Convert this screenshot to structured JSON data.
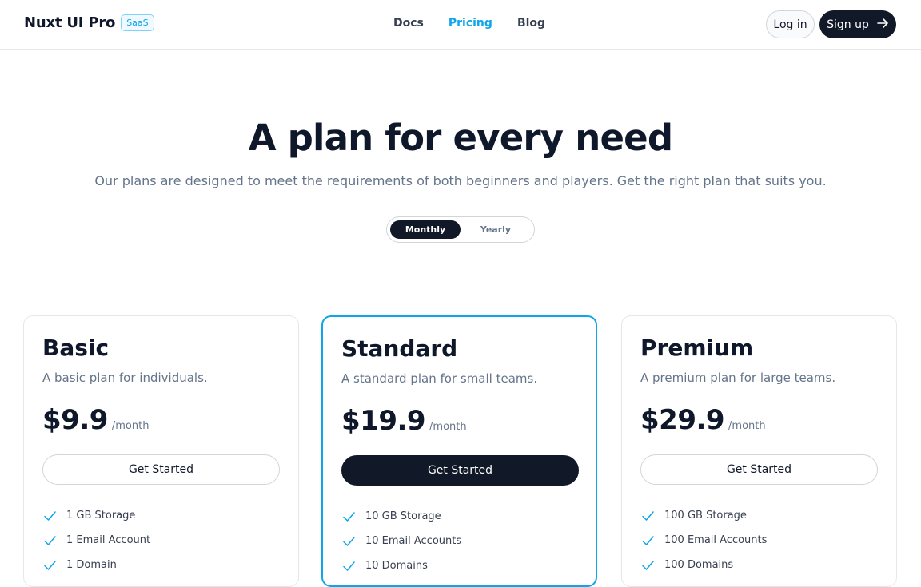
{
  "header": {
    "brand": "Nuxt UI Pro",
    "badge": "SaaS",
    "nav": [
      {
        "label": "Docs",
        "active": false
      },
      {
        "label": "Pricing",
        "active": true
      },
      {
        "label": "Blog",
        "active": false
      }
    ],
    "login_label": "Log in",
    "signup_label": "Sign up"
  },
  "hero": {
    "title": "A plan for every need",
    "subtitle": "Our plans are designed to meet the requirements of both beginners and players. Get the right plan that suits you."
  },
  "billing_toggle": {
    "options": [
      "Monthly",
      "Yearly"
    ],
    "selected": "Monthly"
  },
  "plans": [
    {
      "name": "Basic",
      "description": "A basic plan for individuals.",
      "price": "$9.9",
      "period": "/month",
      "cta": "Get Started",
      "features": [
        "1 GB Storage",
        "1 Email Account",
        "1 Domain"
      ]
    },
    {
      "name": "Standard",
      "description": "A standard plan for small teams.",
      "price": "$19.9",
      "period": "/month",
      "cta": "Get Started",
      "features": [
        "10 GB Storage",
        "10 Email Accounts",
        "10 Domains"
      ]
    },
    {
      "name": "Premium",
      "description": "A premium plan for large teams.",
      "price": "$29.9",
      "period": "/month",
      "cta": "Get Started",
      "features": [
        "100 GB Storage",
        "100 Email Accounts",
        "100 Domains"
      ]
    }
  ],
  "colors": {
    "accent": "#0ea5e9",
    "dark": "#111827",
    "muted": "#64748b"
  }
}
